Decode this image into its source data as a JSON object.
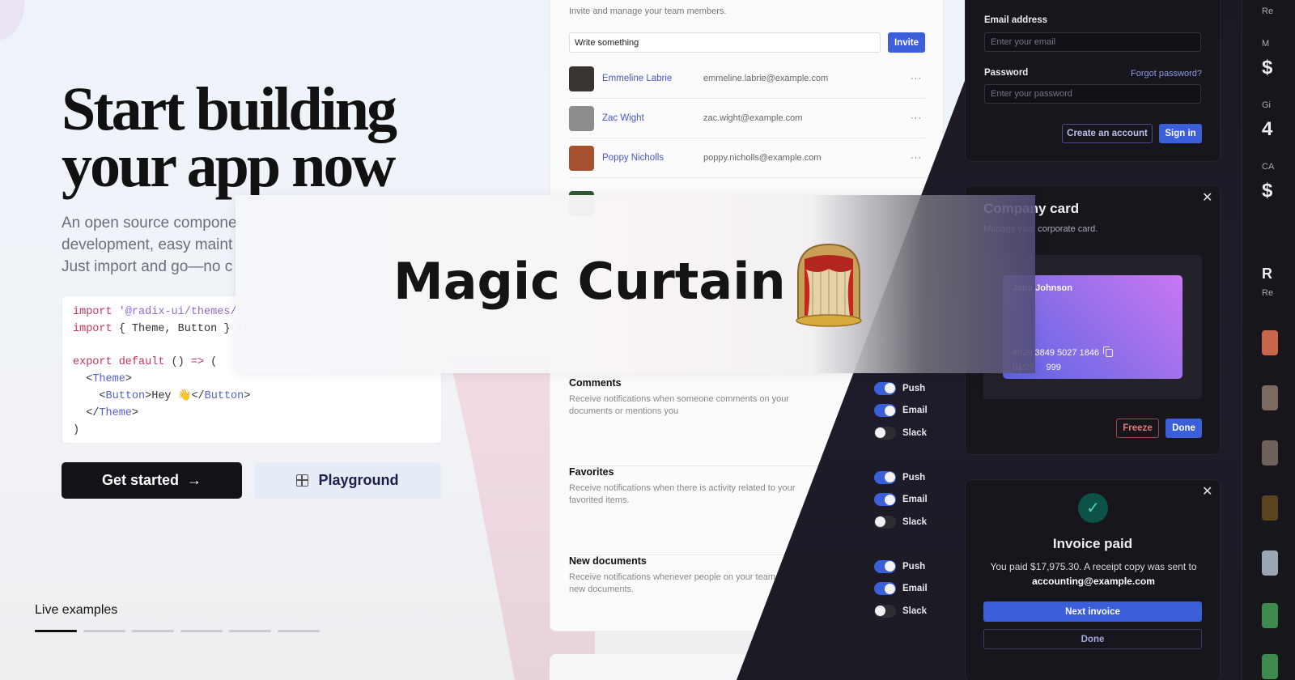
{
  "hero": {
    "title_line1": "Start building",
    "title_line2": "your app now",
    "description_lines": [
      "An open source compone",
      "development, easy maint",
      "Just import and go—no c"
    ],
    "code_lines": [
      [
        {
          "t": "import ",
          "c": "kw"
        },
        {
          "t": "'@radix-ui/themes/sty",
          "c": "str"
        }
      ],
      [
        {
          "t": "import ",
          "c": "kw"
        },
        {
          "t": "{ Theme, Button } ",
          "c": ""
        },
        {
          "t": "fr",
          "c": "kw"
        }
      ],
      [],
      [
        {
          "t": "export default ",
          "c": "kw"
        },
        {
          "t": "() ",
          "c": ""
        },
        {
          "t": "=> ",
          "c": "kw"
        },
        {
          "t": "(",
          "c": ""
        }
      ],
      [
        {
          "t": "  <",
          "c": ""
        },
        {
          "t": "Theme",
          "c": "tag"
        },
        {
          "t": ">",
          "c": ""
        }
      ],
      [
        {
          "t": "    <",
          "c": ""
        },
        {
          "t": "Button",
          "c": "tag"
        },
        {
          "t": ">Hey 👋</",
          "c": ""
        },
        {
          "t": "Button",
          "c": "tag"
        },
        {
          "t": ">",
          "c": ""
        }
      ],
      [
        {
          "t": "  </",
          "c": ""
        },
        {
          "t": "Theme",
          "c": "tag"
        },
        {
          "t": ">",
          "c": ""
        }
      ],
      [
        {
          "t": ")",
          "c": ""
        }
      ]
    ],
    "get_started_label": "Get started",
    "arrow": "→",
    "playground_label": "Playground",
    "live_examples_label": "Live examples",
    "live_tab_count": 6,
    "live_tab_active": 0
  },
  "members": {
    "subtitle": "Invite and manage your team members.",
    "input_value": "Write something",
    "invite_label": "Invite",
    "more": "···",
    "rows": [
      {
        "name": "Emmeline Labrie",
        "email": "emmeline.labrie@example.com",
        "avatar_color": "#3a3530"
      },
      {
        "name": "Zac Wight",
        "email": "zac.wight@example.com",
        "avatar_color": "#8d8d8d"
      },
      {
        "name": "Poppy Nicholls",
        "email": "poppy.nicholls@example.com",
        "avatar_color": "#a5502f"
      }
    ]
  },
  "notifications": {
    "sections": [
      {
        "title": "Comments",
        "desc": "Receive notifications when someone comments on your documents or mentions you",
        "toggles": [
          {
            "label": "Push",
            "on": true
          },
          {
            "label": "Email",
            "on": true
          },
          {
            "label": "Slack",
            "on": false
          }
        ]
      },
      {
        "title": "Favorites",
        "desc": "Receive notifications when there is activity related to your favorited items.",
        "toggles": [
          {
            "label": "Push",
            "on": true
          },
          {
            "label": "Email",
            "on": true
          },
          {
            "label": "Slack",
            "on": false
          }
        ]
      },
      {
        "title": "New documents",
        "desc": "Receive notifications whenever people on your team create new documents.",
        "toggles": [
          {
            "label": "Push",
            "on": true
          },
          {
            "label": "Email",
            "on": true
          },
          {
            "label": "Slack",
            "on": false
          }
        ]
      }
    ]
  },
  "signin": {
    "email_label": "Email address",
    "email_placeholder": "Enter your email",
    "password_label": "Password",
    "forgot_label": "Forgot password?",
    "password_placeholder": "Enter your password",
    "create_label": "Create an account",
    "signin_label": "Sign in"
  },
  "company_card": {
    "title": "Company card",
    "subtitle": "Manage your corporate card.",
    "holder": "Jane Johnson",
    "number": "4929 3849 5027 1846",
    "expiry": "01/27",
    "cvc": "999",
    "freeze_label": "Freeze",
    "done_label": "Done",
    "close": "✕"
  },
  "invoice": {
    "check": "✓",
    "title": "Invoice paid",
    "text": "You paid $17,975.30. A receipt copy was sent to",
    "email": "accounting@example.com",
    "next_label": "Next invoice",
    "done_label": "Done",
    "close": "✕"
  },
  "far_column": {
    "labels": [
      "Re",
      "M",
      "$",
      "Gi",
      "4",
      "CA",
      "$",
      "R",
      "Re"
    ]
  },
  "banner": {
    "title": "Magic Curtain"
  },
  "colors": {
    "accent": "#3b5fd9",
    "dark_bg": "#17161d",
    "success": "#3ed9b2"
  }
}
